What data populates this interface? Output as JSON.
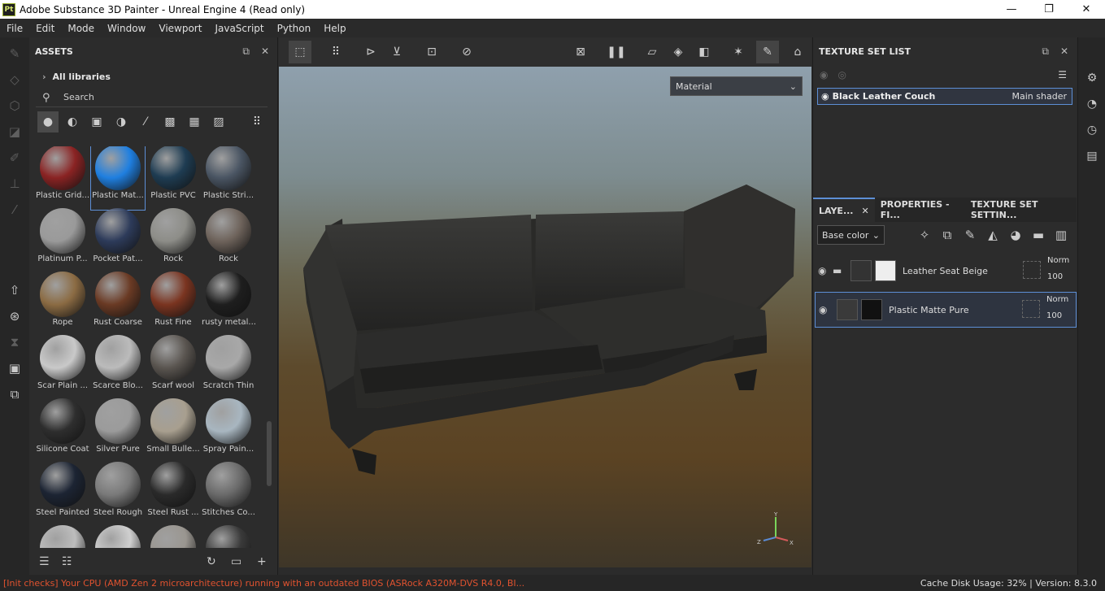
{
  "window": {
    "title": "Adobe Substance 3D Painter - Unreal Engine 4 (Read only)",
    "app_icon": "Pt",
    "controls": [
      "—",
      "❐",
      "✕"
    ]
  },
  "menu": [
    "File",
    "Edit",
    "Mode",
    "Window",
    "Viewport",
    "JavaScript",
    "Python",
    "Help"
  ],
  "assets": {
    "title": "ASSETS",
    "library": "All libraries",
    "search_placeholder": "Search",
    "items": [
      {
        "label": "Plastic Grid...",
        "color": "#8a2323"
      },
      {
        "label": "Plastic Mat...",
        "color": "#1f7fe0",
        "selected": true
      },
      {
        "label": "Plastic PVC",
        "color": "#1e3c52"
      },
      {
        "label": "Plastic Stri...",
        "color": "#4a5563"
      },
      {
        "label": "Platinum P...",
        "color": "#9a9a9a"
      },
      {
        "label": "Pocket Pat...",
        "color": "#2d3b5a"
      },
      {
        "label": "Rock",
        "color": "#8d8d88"
      },
      {
        "label": "Rock",
        "color": "#6e635b"
      },
      {
        "label": "Rope",
        "color": "#8b6b43"
      },
      {
        "label": "Rust Coarse",
        "color": "#6a3a24"
      },
      {
        "label": "Rust Fine",
        "color": "#7a3420"
      },
      {
        "label": "rusty metal...",
        "color": "#1e1e1e"
      },
      {
        "label": "Scar Plain ...",
        "color": "#c9c9c9"
      },
      {
        "label": "Scarce Blo...",
        "color": "#bbbbbb"
      },
      {
        "label": "Scarf wool",
        "color": "#5a5550"
      },
      {
        "label": "Scratch Thin",
        "color": "#a8a8a8"
      },
      {
        "label": "Silicone Coat",
        "color": "#2e2e2e"
      },
      {
        "label": "Silver Pure",
        "color": "#9b9b9b"
      },
      {
        "label": "Small Bulle...",
        "color": "#a89f8f"
      },
      {
        "label": "Spray Pain...",
        "color": "#a8b6c0"
      },
      {
        "label": "Steel Painted",
        "color": "#1c2433"
      },
      {
        "label": "Steel Rough",
        "color": "#7a7a7a"
      },
      {
        "label": "Steel Rust ...",
        "color": "#2a2a2a"
      },
      {
        "label": "Stitches Co...",
        "color": "#6a6a6a"
      },
      {
        "label": "",
        "color": "#bdbdbd"
      },
      {
        "label": "",
        "color": "#cfcfcf"
      },
      {
        "label": "",
        "color": "#9a9690"
      },
      {
        "label": "",
        "color": "#3a3a3a"
      }
    ]
  },
  "viewport": {
    "material_select": "Material",
    "axis": {
      "x": "X",
      "y": "Y",
      "z": "Z"
    }
  },
  "texture_set_list": {
    "title": "TEXTURE SET LIST",
    "set_name": "Black Leather Couch",
    "shader": "Main shader"
  },
  "layers": {
    "tabs": [
      "LAYE...",
      "PROPERTIES - FI...",
      "TEXTURE SET SETTIN..."
    ],
    "channel": "Base color",
    "items": [
      {
        "name": "Leather Seat Beige",
        "blend": "Norm",
        "opacity": "100"
      },
      {
        "name": "Plastic Matte Pure",
        "blend": "Norm",
        "opacity": "100"
      }
    ]
  },
  "status": {
    "error": "[Init checks] Your CPU (AMD Zen 2 microarchitecture) running with an outdated BIOS (ASRock A320M-DVS R4.0, BI...",
    "right": "Cache Disk Usage:   32% | Version: 8.3.0"
  }
}
